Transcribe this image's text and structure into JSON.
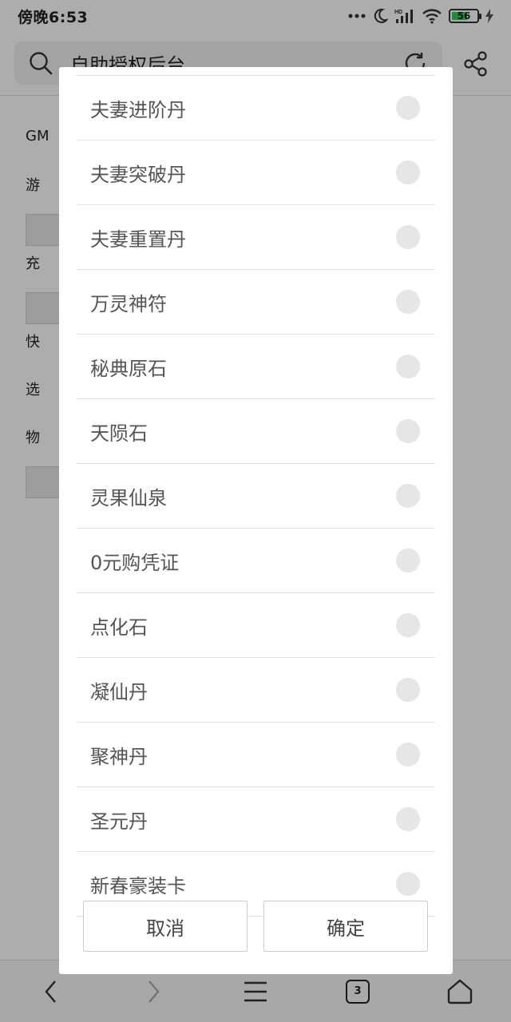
{
  "status_bar": {
    "time": "傍晚6:53",
    "network": "HD",
    "battery": "56"
  },
  "browser": {
    "title": "自助授权后台"
  },
  "page": {
    "labels": [
      "GM",
      "游",
      "充",
      "快",
      "选",
      "物"
    ]
  },
  "dialog": {
    "options": [
      "夫妻进阶丹",
      "夫妻突破丹",
      "夫妻重置丹",
      "万灵神符",
      "秘典原石",
      "天陨石",
      "灵果仙泉",
      "0元购凭证",
      "点化石",
      "凝仙丹",
      "聚神丹",
      "圣元丹",
      "新春豪装卡"
    ],
    "cancel_label": "取消",
    "confirm_label": "确定"
  },
  "bottom_nav": {
    "tab_count": "3"
  }
}
